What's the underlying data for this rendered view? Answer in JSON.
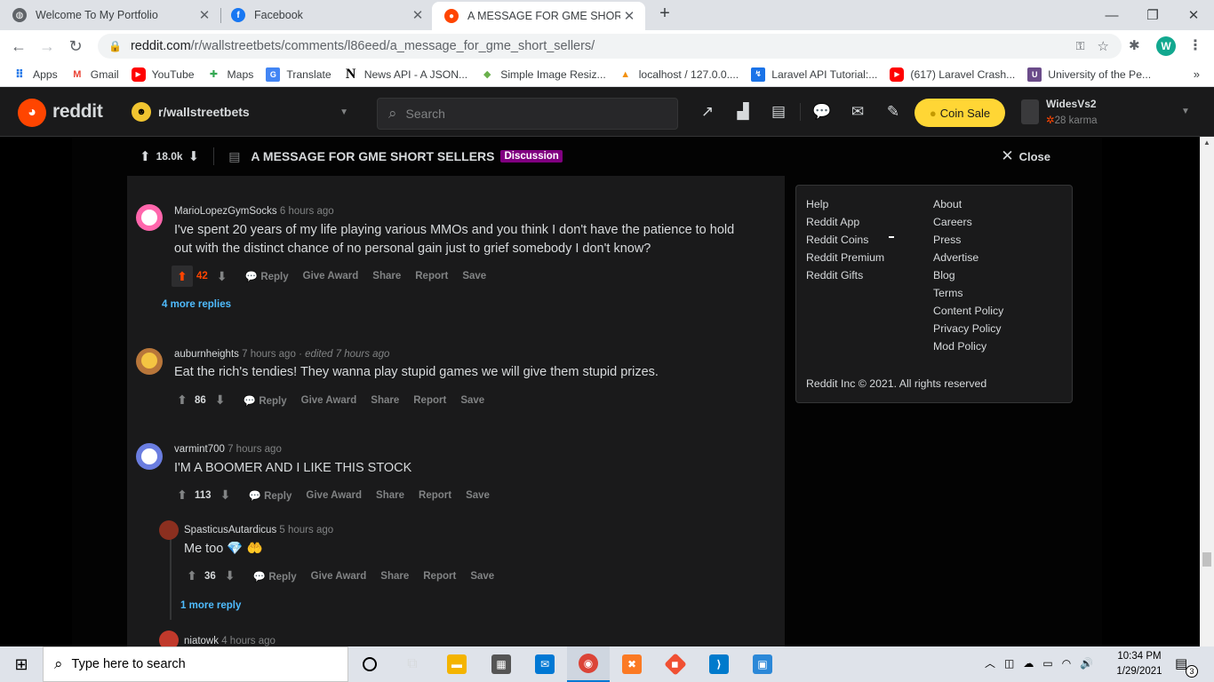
{
  "browser": {
    "tabs": [
      {
        "title": "Welcome To My Portfolio",
        "icon": "globe-icon"
      },
      {
        "title": "Facebook",
        "icon": "facebook-icon"
      },
      {
        "title": "A MESSAGE FOR GME SHORT SEL",
        "icon": "reddit-icon"
      }
    ],
    "url_host": "reddit.com",
    "url_path": "/r/wallstreetbets/comments/l86eed/a_message_for_gme_short_sellers/",
    "profile_initial": "W",
    "bookmarks": [
      {
        "label": "Apps",
        "icon": "apps-grid-icon"
      },
      {
        "label": "Gmail",
        "icon": "gmail-icon"
      },
      {
        "label": "YouTube",
        "icon": "youtube-icon"
      },
      {
        "label": "Maps",
        "icon": "maps-icon"
      },
      {
        "label": "Translate",
        "icon": "translate-icon"
      },
      {
        "label": "News API - A JSON...",
        "icon": "news-icon"
      },
      {
        "label": "Simple Image Resiz...",
        "icon": "image-resize-icon"
      },
      {
        "label": "localhost / 127.0.0....",
        "icon": "phpmyadmin-icon"
      },
      {
        "label": "Laravel API Tutorial:...",
        "icon": "laravel-icon"
      },
      {
        "label": "(617) Laravel Crash...",
        "icon": "youtube-icon"
      },
      {
        "label": "University of the Pe...",
        "icon": "university-icon"
      }
    ]
  },
  "reddit": {
    "brand": "reddit",
    "subreddit": "r/wallstreetbets",
    "search_placeholder": "Search",
    "coin_sale": "Coin Sale",
    "username": "WidesVs2",
    "karma": "28 karma",
    "accent": "#ff4500"
  },
  "post": {
    "score": "18.0k",
    "title": "A MESSAGE FOR GME SHORT SELLERS",
    "flair": "Discussion",
    "flair_color": "#800080",
    "close_label": "Close"
  },
  "comments": [
    {
      "user": "MarioLopezGymSocks",
      "time": "6 hours ago",
      "edited": "",
      "text": "I've spent 20 years of my life playing various MMOs and you think I don't have the patience to hold out with the distinct chance of no personal gain just to grief somebody I don't know?",
      "score": "42",
      "upvoted": true,
      "more": "4 more replies"
    },
    {
      "user": "auburnheights",
      "time": "7 hours ago",
      "edited": "· edited 7 hours ago",
      "text": "Eat the rich's tendies! They wanna play stupid games we will give them stupid prizes.",
      "score": "86",
      "upvoted": false,
      "more": ""
    },
    {
      "user": "varmint700",
      "time": "7 hours ago",
      "edited": "",
      "text": "I'M A BOOMER AND I LIKE THIS STOCK",
      "score": "113",
      "upvoted": false,
      "more": ""
    },
    {
      "user": "SpasticusAutardicus",
      "time": "5 hours ago",
      "edited": "",
      "text": "Me too 💎 🤲",
      "score": "36",
      "upvoted": false,
      "more": "1 more reply"
    },
    {
      "user": "niatowk",
      "time": "4 hours ago",
      "edited": "",
      "text": "",
      "score": "",
      "upvoted": false,
      "more": ""
    }
  ],
  "comment_actions": {
    "reply": "Reply",
    "award": "Give Award",
    "share": "Share",
    "report": "Report",
    "save": "Save"
  },
  "footer": {
    "col1": [
      "Help",
      "Reddit App",
      "Reddit Coins",
      "Reddit Premium",
      "Reddit Gifts"
    ],
    "col2": [
      "About",
      "Careers",
      "Press",
      "Advertise",
      "Blog",
      "Terms",
      "Content Policy",
      "Privacy Policy",
      "Mod Policy"
    ],
    "copyright": "Reddit Inc © 2021. All rights reserved"
  },
  "taskbar": {
    "search_placeholder": "Type here to search",
    "time": "10:34 PM",
    "date": "1/29/2021",
    "notifications": "3"
  }
}
